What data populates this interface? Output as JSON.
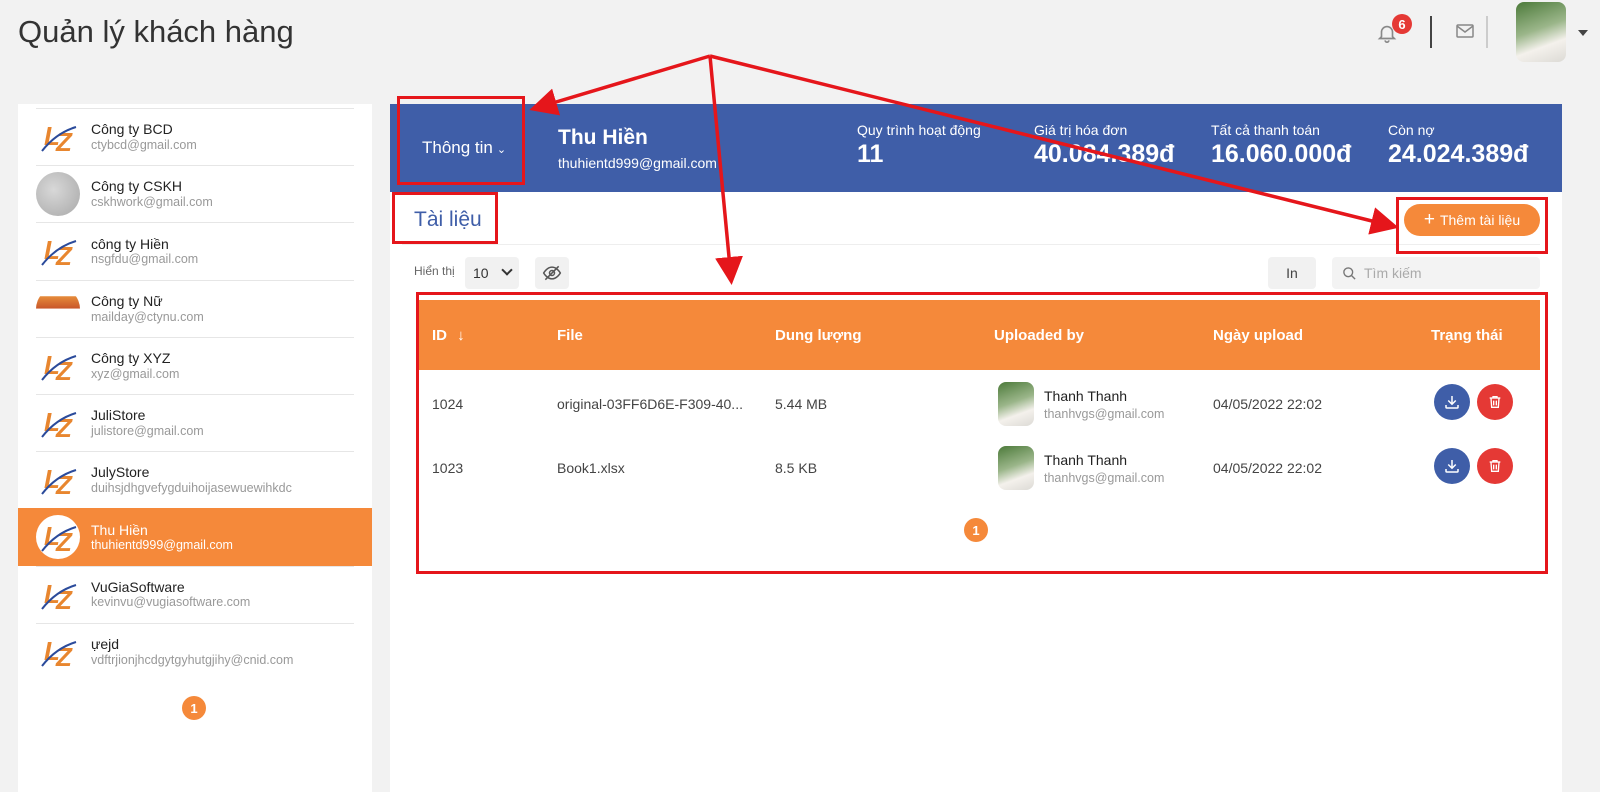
{
  "header": {
    "title": "Quản lý khách hàng",
    "notif_count": "6"
  },
  "sidebar": {
    "customers": [
      {
        "name": "Công ty BCD",
        "email": "ctybcd@gmail.com",
        "logo": "lz-logo"
      },
      {
        "name": "Công ty CSKH",
        "email": "cskhwork@gmail.com",
        "logo": "grey-logo"
      },
      {
        "name": "công ty Hiền",
        "email": "nsgfdu@gmail.com",
        "logo": "lz-logo"
      },
      {
        "name": "Công ty Nữ",
        "email": "mailday@ctynu.com",
        "logo": "sunset-logo"
      },
      {
        "name": "Công ty XYZ",
        "email": "xyz@gmail.com",
        "logo": "lz-logo"
      },
      {
        "name": "JuliStore",
        "email": "julistore@gmail.com",
        "logo": "lz-logo"
      },
      {
        "name": "JulyStore",
        "email": "duihsjdhgvefygduihoijasewuewihkdc",
        "logo": "lz-logo"
      },
      {
        "name": "Thu Hiền",
        "email": "thuhientd999@gmail.com",
        "logo": "lz-logo",
        "active": true
      },
      {
        "name": "VuGiaSoftware",
        "email": "kevinvu@vugiasoftware.com",
        "logo": "lz-logo"
      },
      {
        "name": "ựejd",
        "email": "vdftrjionjhcdgytgyhutgjihy@cnid.com",
        "logo": "lz-logo"
      }
    ],
    "page": "1"
  },
  "customer_header": {
    "info_label": "Thông tin",
    "name": "Thu Hiền",
    "email": "thuhientd999@gmail.com",
    "stats": [
      {
        "label": "Quy trình hoạt động",
        "value": "11"
      },
      {
        "label": "Giá trị hóa đơn",
        "value": "40.084.389đ"
      },
      {
        "label": "Tất cả thanh toán",
        "value": "16.060.000đ"
      },
      {
        "label": "Còn nợ",
        "value": "24.024.389đ"
      }
    ]
  },
  "documents": {
    "title": "Tài liệu",
    "add_label": "Thêm tài liệu",
    "show_label": "Hiển thị",
    "page_size": "10",
    "print_label": "In",
    "search_placeholder": "Tìm kiếm",
    "columns": [
      "ID",
      "File",
      "Dung lượng",
      "Uploaded by",
      "Ngày upload",
      "Trạng thái"
    ],
    "rows": [
      {
        "id": "1024",
        "file": "original-03FF6D6E-F309-40...",
        "size": "5.44 MB",
        "uploader": "Thanh Thanh",
        "uploader_email": "thanhvgs@gmail.com",
        "date": "04/05/2022 22:02"
      },
      {
        "id": "1023",
        "file": "Book1.xlsx",
        "size": "8.5 KB",
        "uploader": "Thanh Thanh",
        "uploader_email": "thanhvgs@gmail.com",
        "date": "04/05/2022 22:02"
      }
    ],
    "page": "1"
  },
  "colors": {
    "primary_blue": "#3f5ea8",
    "accent_orange": "#f5893a",
    "danger_red": "#e53935",
    "annotation_red": "#e5161b"
  }
}
